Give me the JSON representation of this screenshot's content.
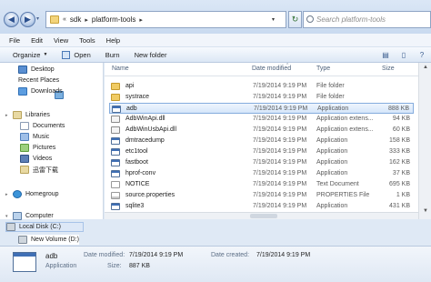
{
  "address": {
    "recent_pages": "▾",
    "crumbs": [
      "«",
      "sdk",
      "▸",
      "platform-tools",
      "▸"
    ],
    "dropdown": "▾",
    "refresh": "↻"
  },
  "search": {
    "placeholder": "Search platform-tools"
  },
  "menu": [
    "File",
    "Edit",
    "View",
    "Tools",
    "Help"
  ],
  "toolbar": {
    "organize": "Organize",
    "open": "Open",
    "burn": "Burn",
    "new_folder": "New folder"
  },
  "nav": {
    "favorites": [
      "Desktop",
      "Recent Places",
      "Downloads"
    ],
    "libraries": "Libraries",
    "library_items": [
      "Documents",
      "Music",
      "Pictures",
      "Videos",
      "迅雷下载"
    ],
    "homegroup": "Homegroup",
    "computer": "Computer",
    "drives": [
      "Local Disk (C:)",
      "New Volume (D:)"
    ]
  },
  "columns": {
    "name": "Name",
    "date": "Date modified",
    "type": "Type",
    "size": "Size"
  },
  "files": [
    {
      "name": "api",
      "date": "7/19/2014 9:19 PM",
      "type": "File folder",
      "size": "",
      "icon": "folder"
    },
    {
      "name": "systrace",
      "date": "7/19/2014 9:19 PM",
      "type": "File folder",
      "size": "",
      "icon": "folder"
    },
    {
      "name": "adb",
      "date": "7/19/2014 9:19 PM",
      "type": "Application",
      "size": "888 KB",
      "icon": "app"
    },
    {
      "name": "AdbWinApi.dll",
      "date": "7/19/2014 9:19 PM",
      "type": "Application extens...",
      "size": "94 KB",
      "icon": "dll"
    },
    {
      "name": "AdbWinUsbApi.dll",
      "date": "7/19/2014 9:19 PM",
      "type": "Application extens...",
      "size": "60 KB",
      "icon": "dll"
    },
    {
      "name": "dmtracedump",
      "date": "7/19/2014 9:19 PM",
      "type": "Application",
      "size": "158 KB",
      "icon": "app"
    },
    {
      "name": "etc1tool",
      "date": "7/19/2014 9:19 PM",
      "type": "Application",
      "size": "333 KB",
      "icon": "app"
    },
    {
      "name": "fastboot",
      "date": "7/19/2014 9:19 PM",
      "type": "Application",
      "size": "162 KB",
      "icon": "app"
    },
    {
      "name": "hprof-conv",
      "date": "7/19/2014 9:19 PM",
      "type": "Application",
      "size": "37 KB",
      "icon": "app"
    },
    {
      "name": "NOTICE",
      "date": "7/19/2014 9:19 PM",
      "type": "Text Document",
      "size": "695 KB",
      "icon": "txt"
    },
    {
      "name": "source.properties",
      "date": "7/19/2014 9:19 PM",
      "type": "PROPERTIES File",
      "size": "1 KB",
      "icon": "prop"
    },
    {
      "name": "sqlite3",
      "date": "7/19/2014 9:19 PM",
      "type": "Application",
      "size": "431 KB",
      "icon": "app"
    }
  ],
  "details": {
    "name": "adb",
    "type": "Application",
    "modified_label": "Date modified:",
    "modified_value": "7/19/2014 9:19 PM",
    "created_label": "Date created:",
    "created_value": "7/19/2014 9:19 PM",
    "size_label": "Size:",
    "size_value": "887 KB"
  }
}
